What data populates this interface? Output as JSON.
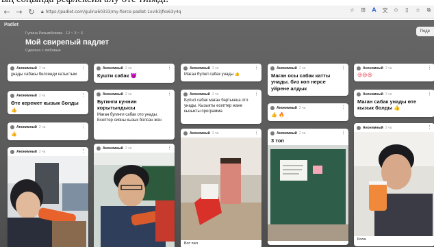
{
  "header_cut_text": "ың соңында рефлексия алу өте тиімді.",
  "browser": {
    "url": "https://padlet.com/gulina60333/my-fierce-padlet-1xvik3jfko63y4q",
    "back_icon": "back-arrow-icon",
    "forward_icon": "forward-arrow-icon",
    "reload_icon": "reload-icon",
    "right_icons": [
      "star-icon",
      "grid-icon",
      "reader-icon",
      "translate-icon",
      "favorite-icon",
      "split-screen-icon",
      "favorites-icon",
      "collections-icon"
    ],
    "accent": "#3a6fd8"
  },
  "board": {
    "logo": "Padlet",
    "meta": "Гүлина Рахымбекова · 12 ~ 3 ~ 3",
    "title": "Мой свирепый падлет",
    "subtitle": "Сделано с любовью",
    "share": "Поде",
    "background": "#5a5a5a"
  },
  "columns": [
    {
      "cards": [
        {
          "author": "Анонимный",
          "time": "2 ча",
          "text": "ұнады сабакы белсенди катыстым"
        },
        {
          "author": "Анонимный",
          "time": "2 ча",
          "title": "Өте керемет кызык болды",
          "emoji": "👍"
        },
        {
          "author": "Анонимный",
          "time": "2 ча",
          "emoji": "👍"
        },
        {
          "author": "Анонимный",
          "time": "2 ча",
          "image": "student-drinking"
        }
      ]
    },
    {
      "cards": [
        {
          "author": "Анонимный",
          "time": "2 ча",
          "title": "Кушти сабак 😈"
        },
        {
          "author": "Анонимный",
          "time": "2 ча",
          "title": "Бугинги куннин корытындысы",
          "text": "Маған бугинги сабак ото унады. Есептер сияны кызык болсан жон"
        },
        {
          "author": "Анонимный",
          "time": "2 ча",
          "image": "student-smiling"
        }
      ]
    },
    {
      "cards": [
        {
          "author": "Анонимный",
          "time": "2 ча",
          "text": "Маған бүгінгі сабак унады 👍"
        },
        {
          "author": "Анонимный",
          "time": "2 ча",
          "text": "Бүгінгі сабак маған бартынша ото унады. Кызыкты есептер жане кызыкты программа"
        },
        {
          "author": "Анонимный",
          "time": "2 ча",
          "image": "cup-on-desk",
          "caption": "Вот пил"
        }
      ]
    },
    {
      "cards": [
        {
          "author": "Анонимный",
          "time": "2 ча",
          "title": "Маған осы сабак катты унады. биз коп нерсе уйрене алдык"
        },
        {
          "author": "Анонимный",
          "time": "2 ча",
          "emoji": "👍 🔥"
        },
        {
          "author": "Анонимный",
          "time": "2 ча",
          "title": "3 топ",
          "image": "classroom-board"
        }
      ]
    },
    {
      "cards": [
        {
          "author": "Анонимный",
          "time": "2 ча",
          "hearts": "😍😍😍"
        },
        {
          "author": "Анонимный",
          "time": "2 ча",
          "title": "Маған сабак унады өте кызык болды 👍"
        },
        {
          "author": "Анонимный",
          "time": "2 ча",
          "image": "student-cup",
          "caption": "Кола"
        }
      ]
    }
  ]
}
